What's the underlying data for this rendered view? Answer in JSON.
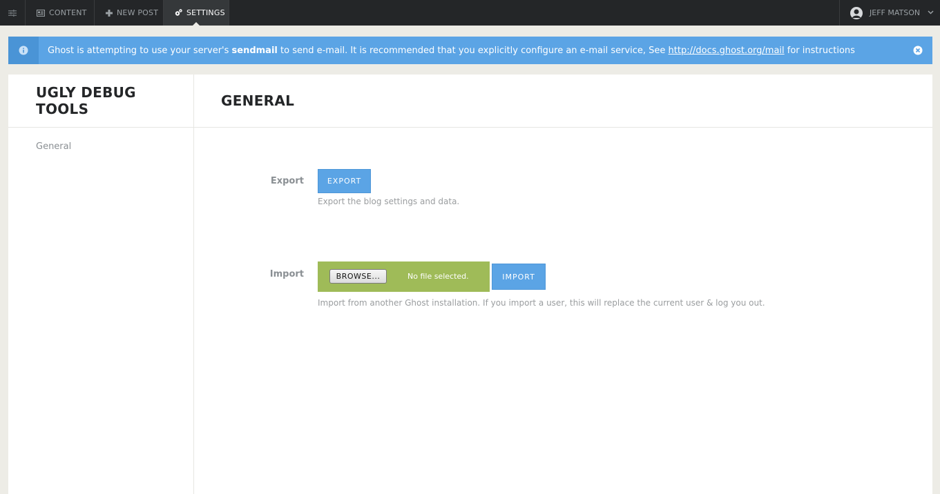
{
  "nav": {
    "items": [
      {
        "label": "CONTENT",
        "icon": "content-icon"
      },
      {
        "label": "NEW POST",
        "icon": "plus-icon"
      },
      {
        "label": "SETTINGS",
        "icon": "gear-icon"
      }
    ],
    "user": {
      "name": "JEFF MATSON",
      "icon": "user-avatar-icon"
    }
  },
  "notice": {
    "text_before": "Ghost is attempting to use your server's ",
    "bold": "sendmail",
    "text_middle": " to send e-mail. It is recommended that you explicitly configure an e-mail service, See ",
    "link": "http://docs.ghost.org/mail",
    "text_after": " for instructions"
  },
  "sidebar": {
    "title": "UGLY DEBUG TOOLS",
    "items": [
      {
        "label": "General"
      }
    ]
  },
  "main": {
    "title": "GENERAL",
    "export": {
      "label": "Export",
      "button": "EXPORT",
      "help": "Export the blog settings and data."
    },
    "import": {
      "label": "Import",
      "browse_button": "BROWSE...",
      "file_status": "No file selected.",
      "button": "IMPORT",
      "help": "Import from another Ghost installation. If you import a user, this will replace the current user & log you out."
    }
  },
  "colors": {
    "topbar": "#242628",
    "accent_blue": "#5ba4e5",
    "file_green": "#9fbb58"
  }
}
